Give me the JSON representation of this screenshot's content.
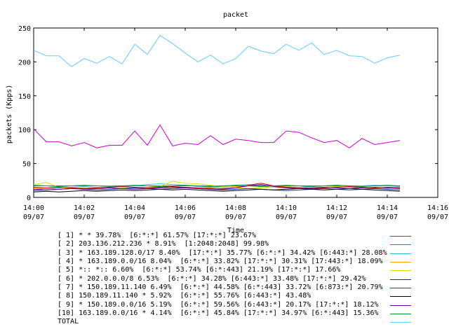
{
  "chart_data": {
    "type": "line",
    "title": "packet",
    "xlabel": "Time",
    "ylabel": "packets (Kpps)",
    "ylim": [
      0,
      250
    ],
    "yticks": [
      0,
      50,
      100,
      150,
      200,
      250
    ],
    "xlim": [
      "14:00",
      "14:16"
    ],
    "xticks": [
      {
        "time": "14:00",
        "date": "09/07"
      },
      {
        "time": "14:02",
        "date": "09/07"
      },
      {
        "time": "14:04",
        "date": "09/07"
      },
      {
        "time": "14:06",
        "date": "09/07"
      },
      {
        "time": "14:08",
        "date": "09/07"
      },
      {
        "time": "14:10",
        "date": "09/07"
      },
      {
        "time": "14:12",
        "date": "09/07"
      },
      {
        "time": "14:14",
        "date": "09/07"
      },
      {
        "time": "14:16",
        "date": "09/07"
      }
    ],
    "x": [
      "14:00:00",
      "14:00:30",
      "14:01:00",
      "14:01:30",
      "14:02:00",
      "14:02:30",
      "14:03:00",
      "14:03:30",
      "14:04:00",
      "14:04:30",
      "14:05:00",
      "14:05:30",
      "14:06:00",
      "14:06:30",
      "14:07:00",
      "14:07:30",
      "14:08:00",
      "14:08:30",
      "14:09:00",
      "14:09:30",
      "14:10:00",
      "14:10:30",
      "14:11:00",
      "14:11:30",
      "14:12:00",
      "14:12:30",
      "14:13:00",
      "14:13:30",
      "14:14:00",
      "14:14:30"
    ],
    "series": [
      {
        "name": "[ 1] * * 39.78%  [6:*:*] 61.57% [17:*:*] 23.67%",
        "color": "#cc00cc",
        "values": [
          101,
          82,
          82,
          76,
          81,
          73,
          77,
          77,
          98,
          77,
          107,
          76,
          80,
          78,
          91,
          78,
          86,
          84,
          81,
          81,
          98,
          96,
          88,
          81,
          84,
          73,
          87,
          78,
          81,
          84
        ]
      },
      {
        "name": "[ 2] 203.136.212.236 * 8.91%  [1:2048:2048] 99.98%",
        "color": "#009999",
        "values": [
          17,
          17,
          17,
          17,
          17,
          17,
          17,
          17,
          17,
          17,
          17,
          17,
          17,
          17,
          17,
          17,
          17,
          17,
          17,
          17,
          17,
          17,
          17,
          17,
          17,
          17,
          17,
          17,
          17,
          17
        ]
      },
      {
        "name": "[ 3] * 163.189.128.0/17 8.40%  [17:*:*] 35.77% [6:*:*] 34.42% [6:443:*] 28.08%",
        "color": "#33bbdd",
        "values": [
          12,
          13,
          14,
          15,
          16,
          17,
          17,
          16,
          17,
          19,
          20,
          19,
          18,
          16,
          15,
          16,
          18,
          19,
          18,
          17,
          16,
          15,
          16,
          17,
          18,
          17,
          17,
          18,
          17,
          16
        ]
      },
      {
        "name": "[ 4] * 163.189.0.0/16 8.04%  [6:*:*] 33.82% [17:*:*] 30.31% [17:443:*] 18.09%",
        "color": "#ff9900",
        "values": [
          14,
          13,
          12,
          13,
          14,
          15,
          14,
          13,
          14,
          15,
          16,
          15,
          14,
          13,
          14,
          15,
          16,
          17,
          16,
          15,
          14,
          13,
          14,
          15,
          16,
          15,
          14,
          13,
          14,
          15
        ]
      },
      {
        "name": "[ 5] *:: *:: 6.60%  [6:*:*] 53.74% [6:*:443] 21.19% [17:*:*] 17.66%",
        "color": "#dddd00",
        "values": [
          19,
          22,
          15,
          13,
          12,
          13,
          12,
          14,
          13,
          15,
          16,
          24,
          21,
          20,
          18,
          16,
          14,
          13,
          14,
          15,
          16,
          15,
          14,
          15,
          16,
          17,
          15,
          14,
          13,
          14
        ]
      },
      {
        "name": "[ 6] * 202.0.0.0/8 6.53%  [6:*:*] 34.28% [6:443:*] 33.48% [17:*:*] 29.42%",
        "color": "#003399",
        "values": [
          10,
          11,
          12,
          13,
          12,
          11,
          12,
          13,
          14,
          13,
          12,
          13,
          14,
          13,
          12,
          11,
          12,
          13,
          12,
          11,
          10,
          11,
          12,
          13,
          12,
          11,
          12,
          13,
          12,
          11
        ]
      },
      {
        "name": "[ 7] * 150.189.11.140 6.49%  [6:*:*] 44.58% [6:*:443] 33.72% [6:873:*] 20.79%",
        "color": "#cc0000",
        "values": [
          15,
          14,
          15,
          14,
          13,
          14,
          15,
          16,
          15,
          14,
          15,
          16,
          15,
          14,
          13,
          12,
          14,
          18,
          21,
          17,
          15,
          14,
          13,
          14,
          15,
          16,
          15,
          14,
          15,
          14
        ]
      },
      {
        "name": "[ 8] 150.189.11.140 * 5.92%  [6:*:*] 55.76% [6:443:*] 43.48%",
        "color": "#000000",
        "values": [
          8,
          9,
          8,
          9,
          10,
          9,
          10,
          11,
          10,
          11,
          12,
          11,
          12,
          11,
          10,
          9,
          10,
          11,
          12,
          11,
          12,
          13,
          12,
          11,
          12,
          13,
          12,
          11,
          10,
          9
        ]
      },
      {
        "name": "[ 9] * 150.189.0.0/16 5.19%  [6:*:*] 59.56% [6:443:*] 20.17% [17:*:*] 18.12%",
        "color": "#660099",
        "values": [
          12,
          11,
          12,
          13,
          12,
          13,
          14,
          13,
          12,
          13,
          14,
          15,
          14,
          13,
          12,
          13,
          14,
          17,
          19,
          16,
          14,
          13,
          14,
          15,
          14,
          13,
          14,
          15,
          14,
          13
        ]
      },
      {
        "name": "[10] 163.189.0.0/16 * 4.14%  [6:*:*] 45.84% [17:*:*] 34.97% [6:*:443] 15.36%",
        "color": "#009933",
        "values": [
          18,
          17,
          16,
          17,
          18,
          17,
          16,
          17,
          18,
          17,
          16,
          17,
          18,
          17,
          16,
          17,
          18,
          17,
          16,
          17,
          18,
          17,
          16,
          17,
          18,
          17,
          16,
          17,
          18,
          17
        ]
      },
      {
        "name": "TOTAL",
        "color": "#66ccff",
        "values": [
          217,
          209,
          209,
          193,
          205,
          198,
          208,
          197,
          226,
          211,
          239,
          227,
          213,
          200,
          210,
          197,
          205,
          223,
          216,
          212,
          226,
          217,
          228,
          211,
          217,
          209,
          208,
          198,
          206,
          210
        ]
      }
    ]
  }
}
